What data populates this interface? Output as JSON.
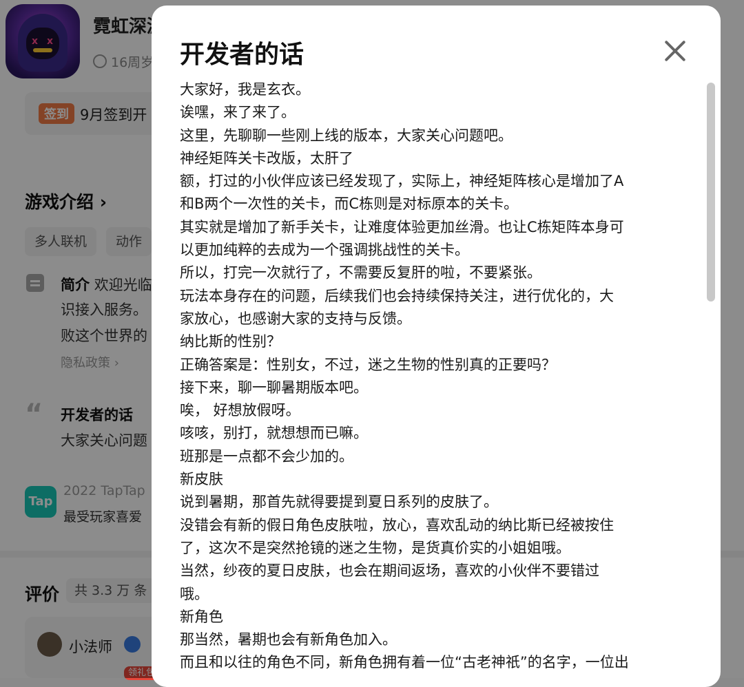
{
  "background": {
    "app_title": "霓虹深渊",
    "app_subtitle": "16周岁",
    "checkin_badge": "签到",
    "checkin_text": "9月签到开",
    "intro_heading": "游戏介绍 ›",
    "tags": [
      "多人联机",
      "动作"
    ],
    "summary_label": "简介",
    "summary_lines": [
      "欢迎光临",
      "识接入服务。",
      "败这个世界的"
    ],
    "privacy_link": "隐私政策 ›",
    "dev_heading": "开发者的话",
    "dev_preview": "大家关心问题",
    "award_logo": "Tap",
    "award_line1": "2022 TapTap",
    "award_line2": "最受玩家喜爱",
    "review_heading": "评价",
    "review_count": "共 3.3 万 条",
    "reviewer_name": "小法师",
    "gift_badge": "领礼包"
  },
  "modal": {
    "title": "开发者的话",
    "lines": [
      "大家好，我是玄衣。",
      "诶嘿，来了来了。",
      "这里，先聊聊一些刚上线的版本，大家关心问题吧。",
      "神经矩阵关卡改版，太肝了",
      "额，打过的小伙伴应该已经发现了，实际上，神经矩阵核心是增加了A",
      "和B两个一次性的关卡，而C栋则是对标原本的关卡。",
      "其实就是增加了新手关卡，让难度体验更加丝滑。也让C栋矩阵本身可",
      "以更加纯粹的去成为一个强调挑战性的关卡。",
      "所以，打完一次就行了，不需要反复肝的啦，不要紧张。",
      "玩法本身存在的问题，后续我们也会持续保持关注，进行优化的，大",
      "家放心，也感谢大家的支持与反馈。",
      "纳比斯的性别？",
      "正确答案是：性别女，不过，迷之生物的性别真的正要吗？",
      "接下来，聊一聊暑期版本吧。",
      "唉， 好想放假呀。",
      "咳咳，别打，就想想而已嘛。",
      "班那是一点都不会少加的。",
      "新皮肤",
      "说到暑期，那首先就得要提到夏日系列的皮肤了。",
      "没错会有新的假日角色皮肤啦，放心，喜欢乱动的纳比斯已经被按住",
      "了，这次不是突然抢镜的迷之生物，是货真价实的小姐姐哦。",
      "当然，纱夜的夏日皮肤，也会在期间返场，喜欢的小伙伴不要错过",
      "哦。",
      "新角色",
      "那当然，暑期也会有新角色加入。",
      "而且和以往的角色不同，新角色拥有着一位“古老神祇”的名字，一位出"
    ]
  }
}
